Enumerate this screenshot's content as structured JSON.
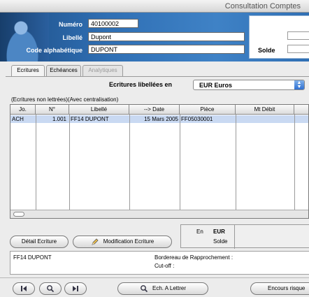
{
  "window": {
    "title": "Consultation Comptes"
  },
  "header": {
    "numero_label": "Numéro",
    "numero_value": "40100002",
    "libelle_label": "Libellé",
    "libelle_value": "Dupont",
    "code_label": "Code alphabétique",
    "code_value": "DUPONT",
    "solde_label": "Solde"
  },
  "tabs": [
    {
      "label": "Ecritures",
      "state": "active"
    },
    {
      "label": "Echéances",
      "state": "normal"
    },
    {
      "label": "Analytiques",
      "state": "disabled"
    }
  ],
  "currency": {
    "label": "Ecritures libellées en",
    "selected": "EUR  Euros"
  },
  "table_note": "(Ecritures non lettrées)(Avec centralisation)",
  "table": {
    "columns": [
      "Jo.",
      "N°",
      "Libellé",
      "--> Date",
      "Pièce",
      "Mt Débit"
    ],
    "rows": [
      [
        "ACH",
        "1.001",
        "FF14 DUPONT",
        "15 Mars 2005",
        "FF05030001",
        ""
      ]
    ]
  },
  "buttons": {
    "detail": "Détail Ecriture",
    "modification": "Modification Ecriture",
    "ech_lettrer": "Ech. A Lettrer",
    "encours": "Encours risque"
  },
  "solde_box": {
    "en_label": "En",
    "currency": "EUR",
    "solde_label": "Solde"
  },
  "info": {
    "libelle": "FF14 DUPONT",
    "bordereau_label": "Bordereau de Rapprochement :",
    "cutoff_label": "Cut-off :"
  },
  "icons": {
    "back": "back-arrow-icon",
    "search": "magnifier-icon",
    "pencil": "pencil-icon"
  }
}
